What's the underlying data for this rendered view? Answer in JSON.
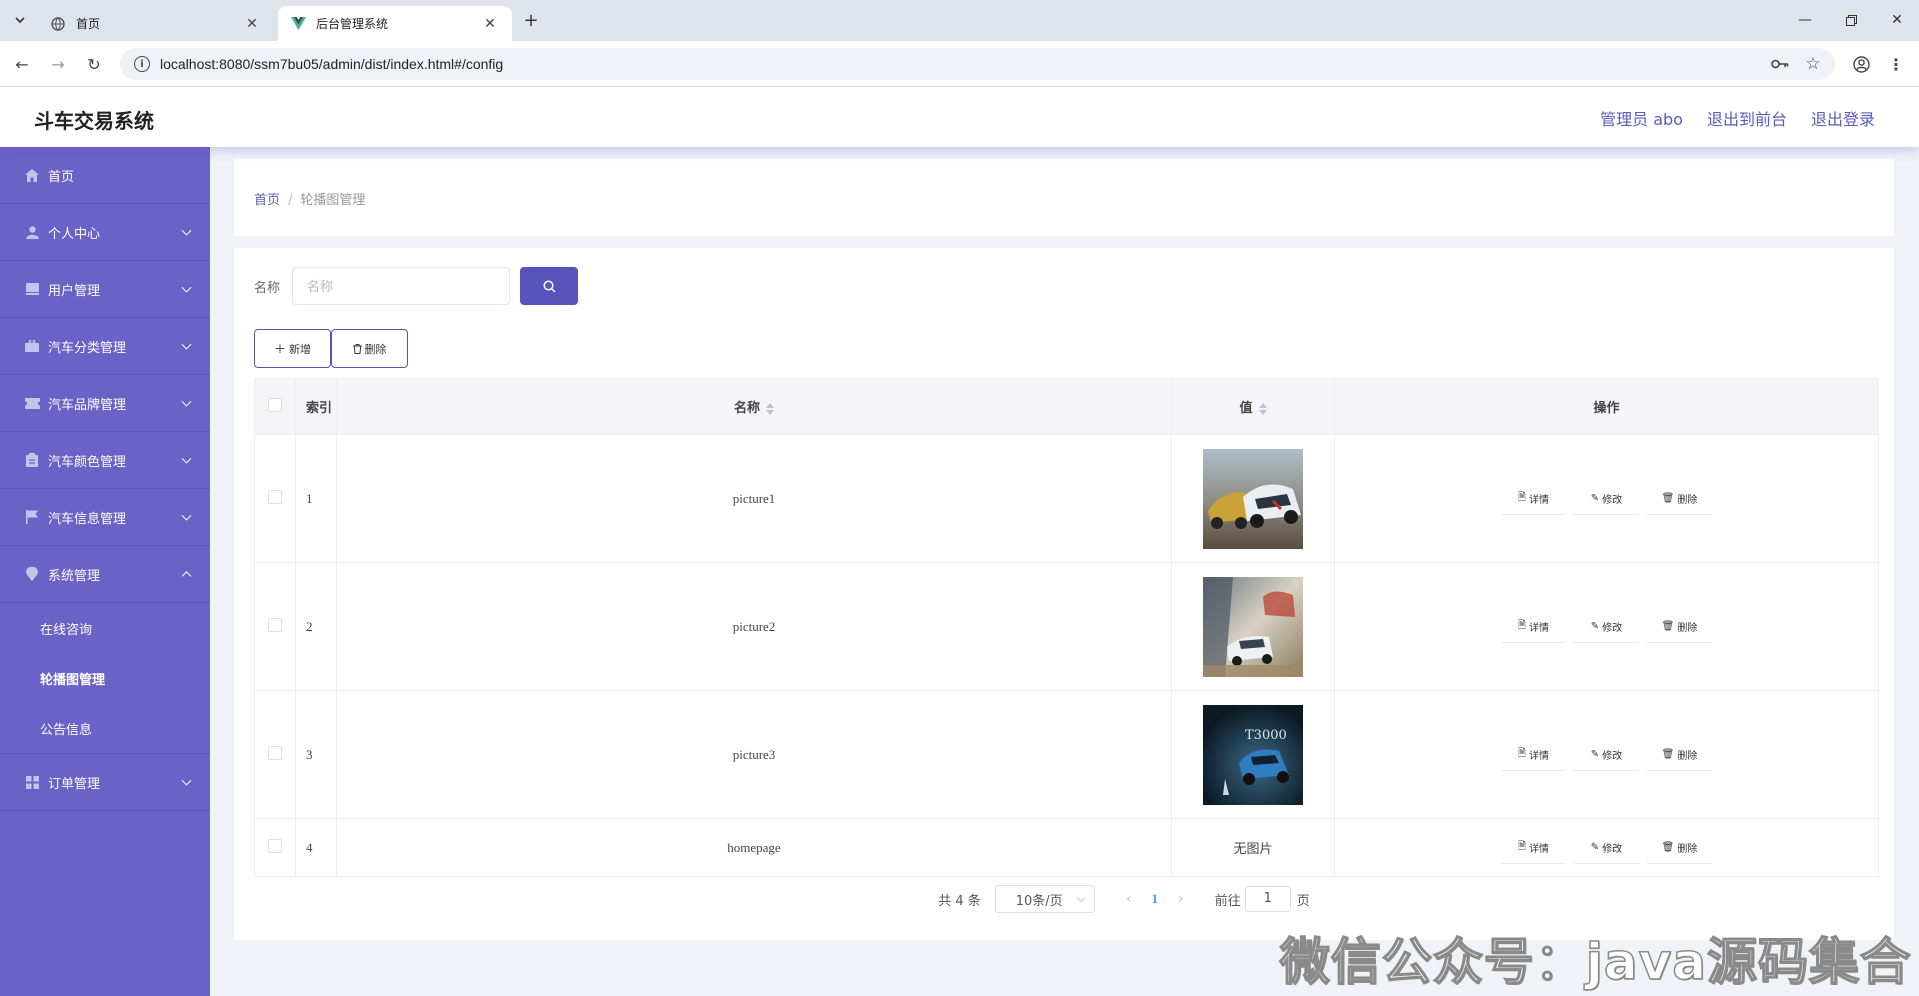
{
  "browser": {
    "tabs": [
      {
        "title": "首页",
        "active": false
      },
      {
        "title": "后台管理系统",
        "active": true
      }
    ],
    "url": "localhost:8080/ssm7bu05/admin/dist/index.html#/config"
  },
  "header": {
    "title": "斗车交易系统",
    "links": [
      "管理员 abo",
      "退出到前台",
      "退出登录"
    ]
  },
  "sidebar": {
    "items": [
      {
        "label": "首页",
        "icon": "home-icon",
        "expandable": false
      },
      {
        "label": "个人中心",
        "icon": "person-icon",
        "expandable": true
      },
      {
        "label": "用户管理",
        "icon": "book-icon",
        "expandable": true
      },
      {
        "label": "汽车分类管理",
        "icon": "briefcase-icon",
        "expandable": true
      },
      {
        "label": "汽车品牌管理",
        "icon": "ticket-icon",
        "expandable": true
      },
      {
        "label": "汽车颜色管理",
        "icon": "clipboard-icon",
        "expandable": true
      },
      {
        "label": "汽车信息管理",
        "icon": "flag-icon",
        "expandable": true
      },
      {
        "label": "系统管理",
        "icon": "location-icon",
        "expandable": true,
        "expanded": true
      },
      {
        "label": "订单管理",
        "icon": "grid-icon",
        "expandable": true
      }
    ],
    "system_submenu": [
      {
        "label": "在线咨询",
        "active": false
      },
      {
        "label": "轮播图管理",
        "active": true
      },
      {
        "label": "公告信息",
        "active": false
      }
    ]
  },
  "breadcrumb": {
    "home": "首页",
    "sep": "/",
    "current": "轮播图管理"
  },
  "search": {
    "label": "名称",
    "placeholder": "名称"
  },
  "actions": {
    "add": "新增",
    "delete": "删除"
  },
  "table": {
    "headers": {
      "index": "索引",
      "name": "名称",
      "value": "值",
      "ops": "操作"
    },
    "rows": [
      {
        "index": "1",
        "name": "picture1",
        "value_type": "image"
      },
      {
        "index": "2",
        "name": "picture2",
        "value_type": "image"
      },
      {
        "index": "3",
        "name": "picture3",
        "value_type": "image"
      },
      {
        "index": "4",
        "name": "homepage",
        "value_type": "text",
        "value_text": "无图片"
      }
    ],
    "op_labels": {
      "detail": "详情",
      "edit": "修改",
      "delete": "删除"
    }
  },
  "pagination": {
    "total": "共 4 条",
    "page_size": "10条/页",
    "current_page": "1",
    "goto_prefix": "前往",
    "goto_value": "1",
    "goto_suffix": "页"
  },
  "watermark": "微信公众号：java源码集合",
  "colors": {
    "accent": "#5753ba",
    "sidebar": "#6a62c6",
    "link": "#5a5bbd"
  }
}
